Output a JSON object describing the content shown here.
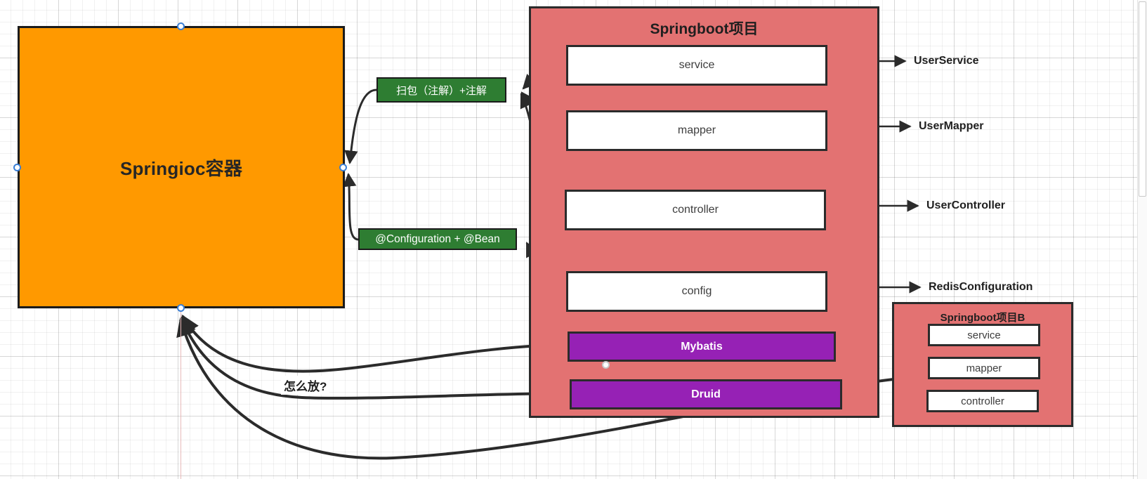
{
  "canvas": {
    "background": "#ffffff",
    "grid": true
  },
  "ioc": {
    "label": "Springioc容器",
    "color": "#FF9900"
  },
  "labels": {
    "scan": "扫包（注解）+注解",
    "config_bean": "@Configuration + @Bean",
    "green_color": "#2E7D32"
  },
  "sb_project": {
    "title": "Springboot项目",
    "color": "#E37272",
    "cards": [
      {
        "label": "service"
      },
      {
        "label": "mapper"
      },
      {
        "label": "controller"
      },
      {
        "label": "config"
      }
    ],
    "libs": [
      {
        "label": "Mybatis",
        "color": "#9621B5"
      },
      {
        "label": "Druid",
        "color": "#9621B5"
      }
    ]
  },
  "outputs": [
    {
      "label": "UserService"
    },
    {
      "label": "UserMapper"
    },
    {
      "label": "UserController"
    },
    {
      "label": "RedisConfiguration"
    }
  ],
  "sb_project_b": {
    "title": "Springboot项目B",
    "cards": [
      {
        "label": "service"
      },
      {
        "label": "mapper"
      },
      {
        "label": "controller"
      }
    ]
  },
  "edge_annotations": {
    "how_to_place": "怎么放?"
  }
}
